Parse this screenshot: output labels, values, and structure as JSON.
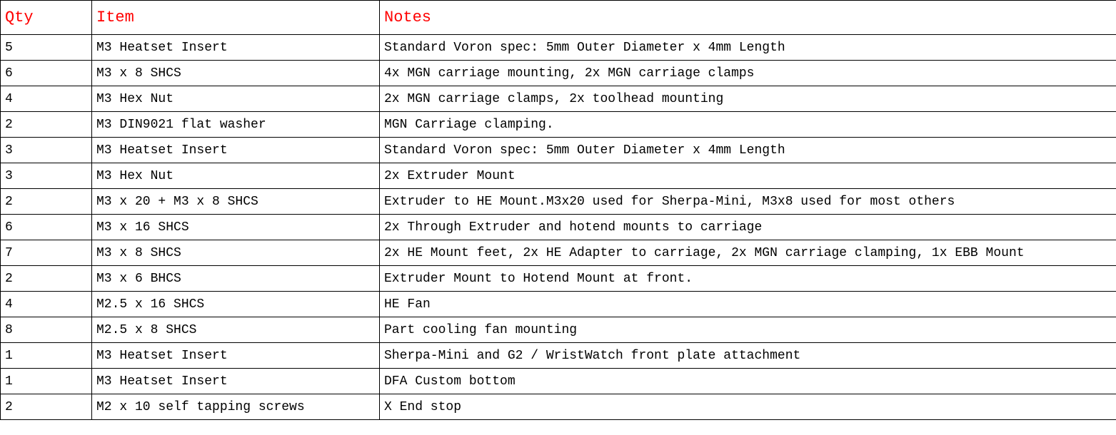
{
  "chart_data": {
    "type": "table",
    "columns": [
      "Qty",
      "Item",
      "Notes"
    ],
    "rows": [
      [
        "5",
        "M3 Heatset Insert",
        "Standard Voron spec: 5mm Outer Diameter x 4mm Length"
      ],
      [
        "6",
        "M3 x 8 SHCS",
        "4x MGN carriage mounting, 2x MGN carriage clamps"
      ],
      [
        "4",
        "M3 Hex Nut",
        "2x MGN carriage clamps, 2x toolhead mounting"
      ],
      [
        "2",
        "M3 DIN9021 flat washer",
        "MGN Carriage clamping."
      ],
      [
        "3",
        "M3 Heatset Insert",
        "Standard Voron spec: 5mm Outer Diameter x 4mm Length"
      ],
      [
        "3",
        "M3 Hex Nut",
        "2x Extruder Mount"
      ],
      [
        "2",
        "M3 x 20 + M3 x 8 SHCS",
        "Extruder to HE Mount.M3x20 used for Sherpa-Mini, M3x8 used for most others"
      ],
      [
        "6",
        "M3 x 16 SHCS",
        "2x Through Extruder and hotend mounts to carriage"
      ],
      [
        "7",
        "M3 x 8 SHCS",
        "2x HE Mount feet, 2x HE Adapter to carriage, 2x MGN carriage clamping, 1x EBB Mount"
      ],
      [
        "2",
        "M3 x 6 BHCS",
        "Extruder Mount to Hotend Mount at front."
      ],
      [
        "4",
        "M2.5 x 16 SHCS",
        "HE Fan"
      ],
      [
        "8",
        "M2.5 x 8 SHCS",
        "Part cooling fan mounting"
      ],
      [
        "1",
        "M3 Heatset Insert",
        "Sherpa-Mini and G2 / WristWatch front plate attachment"
      ],
      [
        "1",
        "M3 Heatset Insert",
        "DFA Custom bottom"
      ],
      [
        "2",
        "M2 x 10 self tapping screws",
        "X End stop"
      ]
    ]
  },
  "headers": {
    "qty": "Qty",
    "item": "Item",
    "notes": "Notes"
  }
}
